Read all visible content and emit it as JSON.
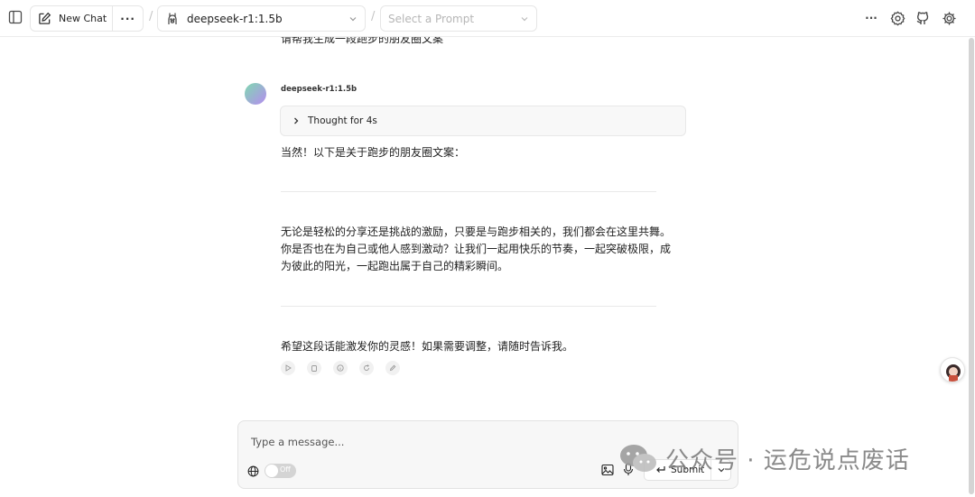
{
  "header": {
    "new_chat_label": "New Chat",
    "model_name": "deepseek-r1:1.5b",
    "prompt_placeholder": "Select a Prompt",
    "breadcrumb_sep": "/"
  },
  "chat": {
    "user_message_partial": "请帮我生成一段跑步的朋友圈文案",
    "assistant_name": "deepseek-r1:1.5b",
    "thought_label": "Thought for 4s",
    "paragraph_1": "当然！以下是关于跑步的朋友圈文案：",
    "paragraph_2_lines": [
      "无论是轻松的分享还是挑战的激励，只要是与跑步相关的，我们都会在这里共舞。",
      "你是否也在为自己或他人感到激动？让我们一起用快乐的节奏，一起突破极限，成",
      "为彼此的阳光，一起跑出属于自己的精彩瞬间。"
    ],
    "paragraph_3": "希望这段话能激发你的灵感！如果需要调整，请随时告诉我。"
  },
  "composer": {
    "placeholder": "Type a message...",
    "toggle_label": "Off",
    "submit_label": "Submit"
  },
  "watermark": {
    "text": "公众号 · 运危说点废话"
  }
}
